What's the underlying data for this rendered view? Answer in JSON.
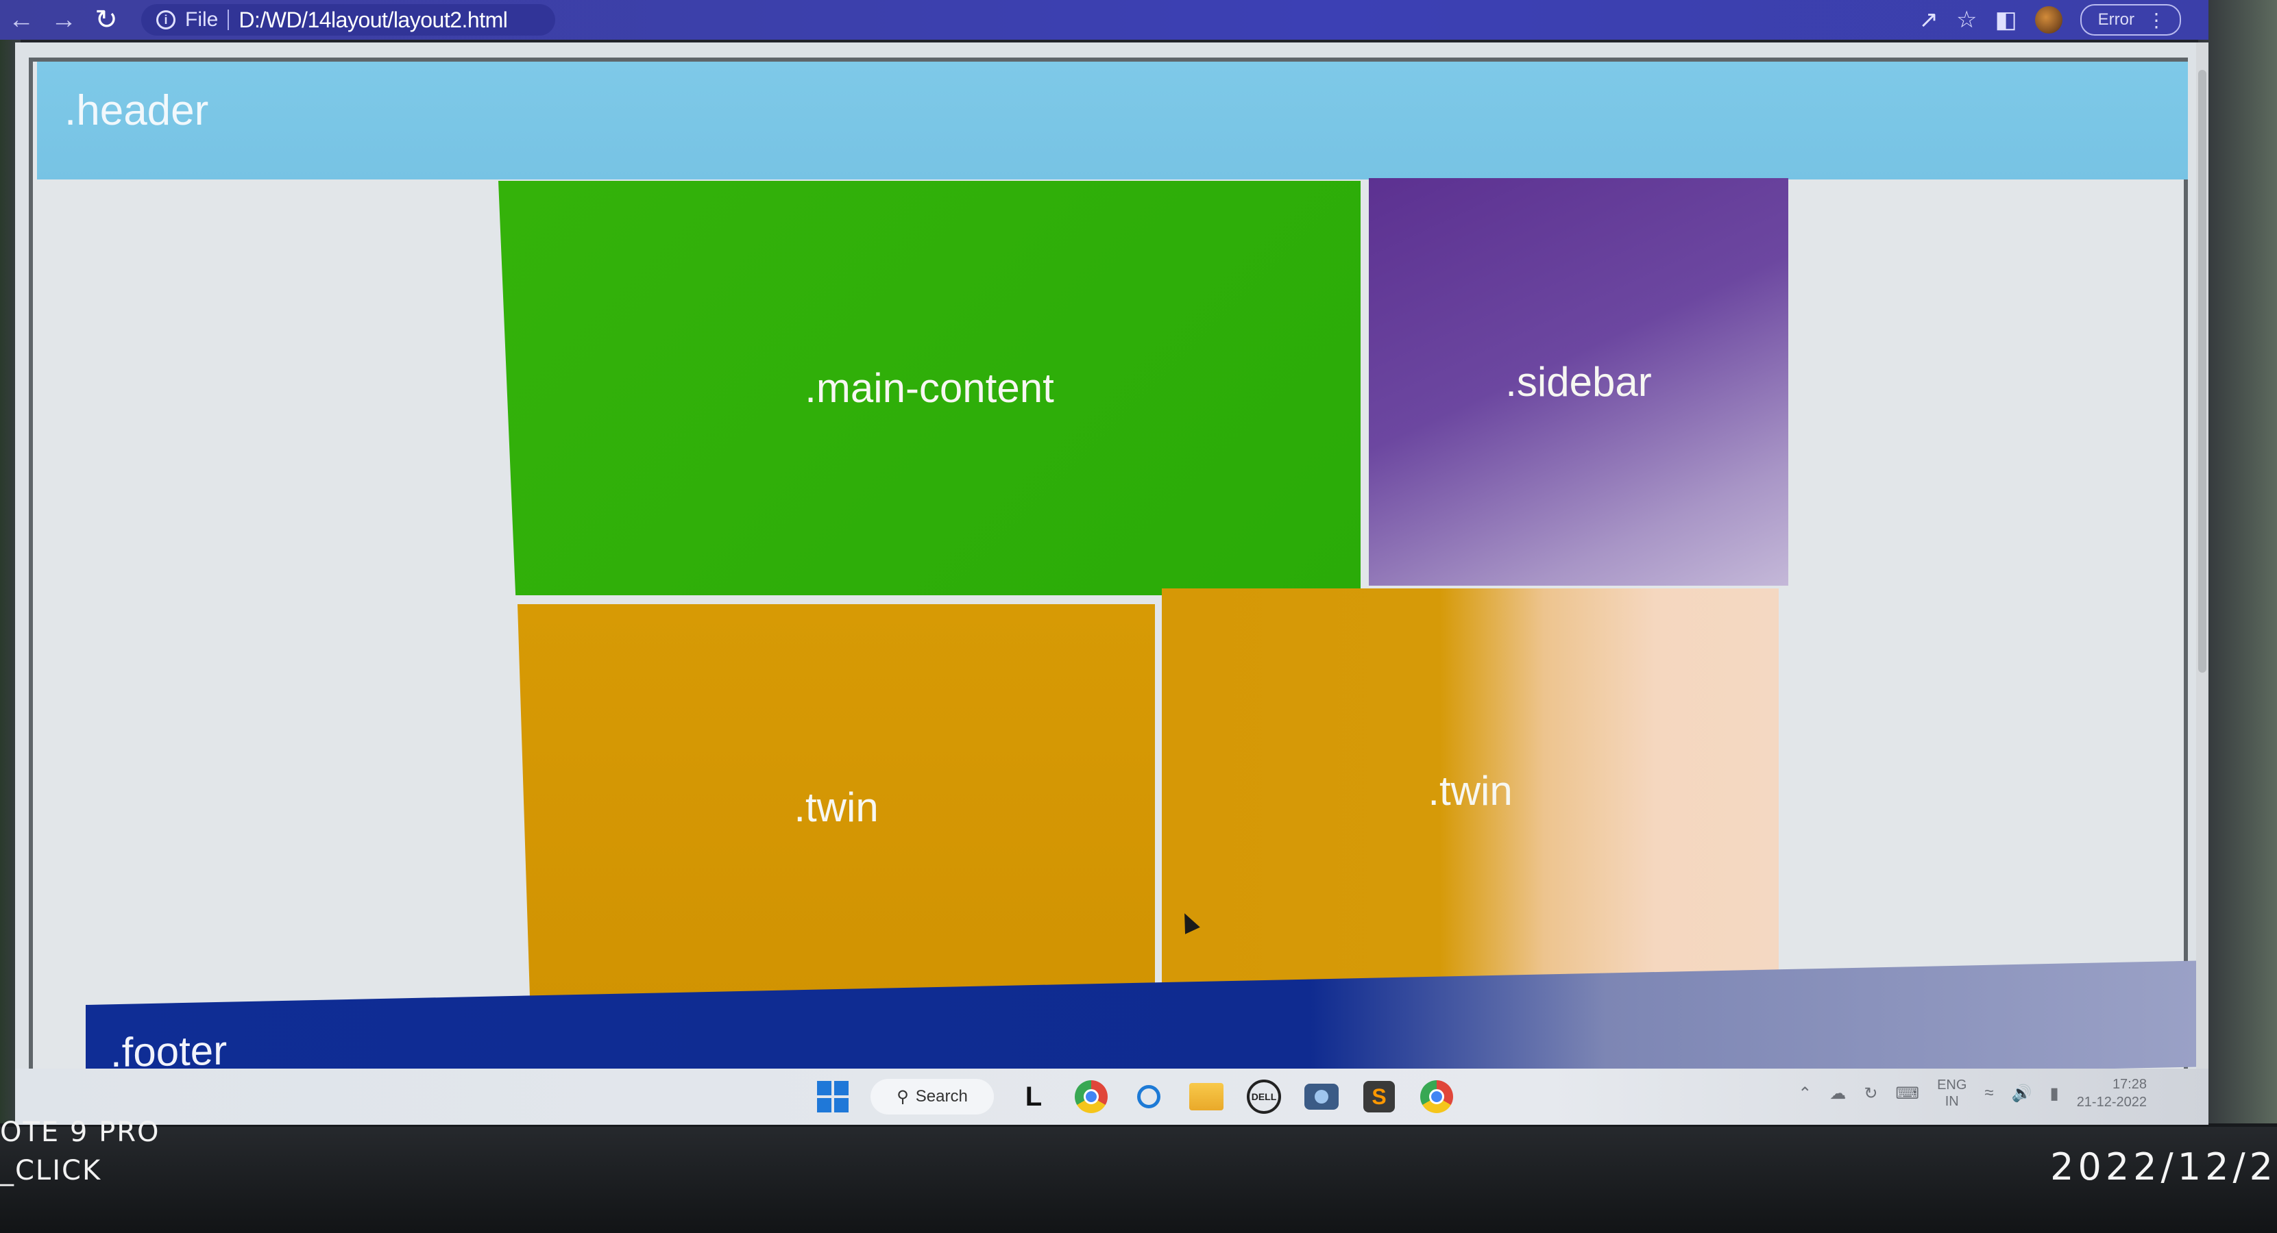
{
  "browser": {
    "url_prefix": "File",
    "url": "D:/WD/14layout/layout2.html",
    "error_label": "Error"
  },
  "page": {
    "header": ".header",
    "main_content": ".main-content",
    "sidebar": ".sidebar",
    "twin_left": ".twin",
    "twin_right": ".twin",
    "footer": ".footer"
  },
  "taskbar": {
    "search_label": "Search",
    "lang_top": "ENG",
    "lang_bottom": "IN",
    "time": "17:28",
    "date": "21-12-2022"
  },
  "photo": {
    "watermark_line1": "OTE 9 PRO",
    "watermark_line2": "_CLICK",
    "datestamp": "2022/12/2"
  },
  "colors": {
    "header": "#7ec9e8",
    "main_content": "#2aab08",
    "sidebar": "#5c3191",
    "twin": "#d69806",
    "footer": "#0f2d95",
    "toolbar": "#3c40b4"
  }
}
